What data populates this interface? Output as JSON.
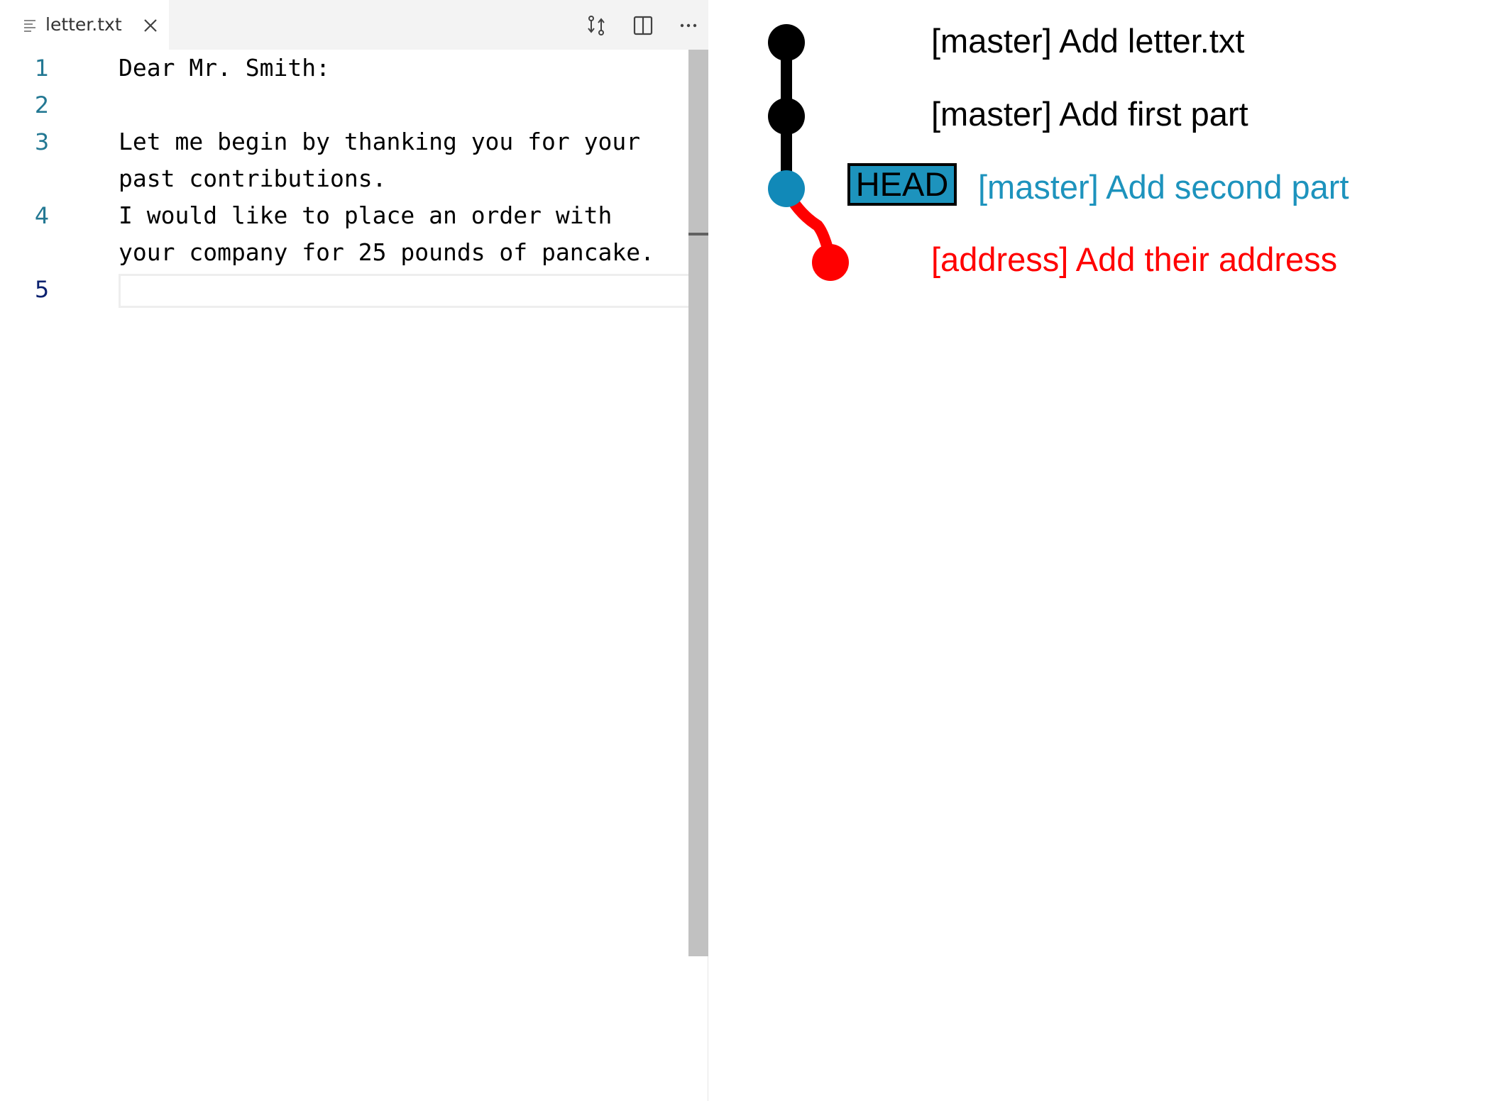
{
  "editor": {
    "tab": {
      "filename": "letter.txt",
      "file_icon": "file-lines-icon",
      "close_icon": "close-icon"
    },
    "toolbar": {
      "icons": [
        "compare-changes-icon",
        "split-editor-icon",
        "more-actions-icon"
      ],
      "more_label": "···"
    },
    "lines": [
      {
        "number": "1",
        "text": "Dear Mr. Smith:"
      },
      {
        "number": "2",
        "text": ""
      },
      {
        "number": "3",
        "text": "Let me begin by thanking you for your",
        "wrap": "past contributions."
      },
      {
        "number": "4",
        "text": "I would like to place an order with",
        "wrap": "your company for 25 pounds of pancake."
      },
      {
        "number": "5",
        "text": ""
      }
    ],
    "active_line": "5"
  },
  "git_graph": {
    "commits": [
      {
        "branch_label": "[master] Add letter.txt",
        "color": "#000000"
      },
      {
        "branch_label": "[master] Add first part",
        "color": "#000000"
      },
      {
        "branch_label": "[master] Add second part",
        "color": "#1d93bd",
        "is_head": true
      },
      {
        "branch_label": "[address] Add their address",
        "color": "#ff0000"
      }
    ],
    "head_label": "HEAD",
    "colors": {
      "master": "#000000",
      "head_commit": "#1189b8",
      "head_text": "#1d93bd",
      "address": "#ff0000"
    }
  }
}
